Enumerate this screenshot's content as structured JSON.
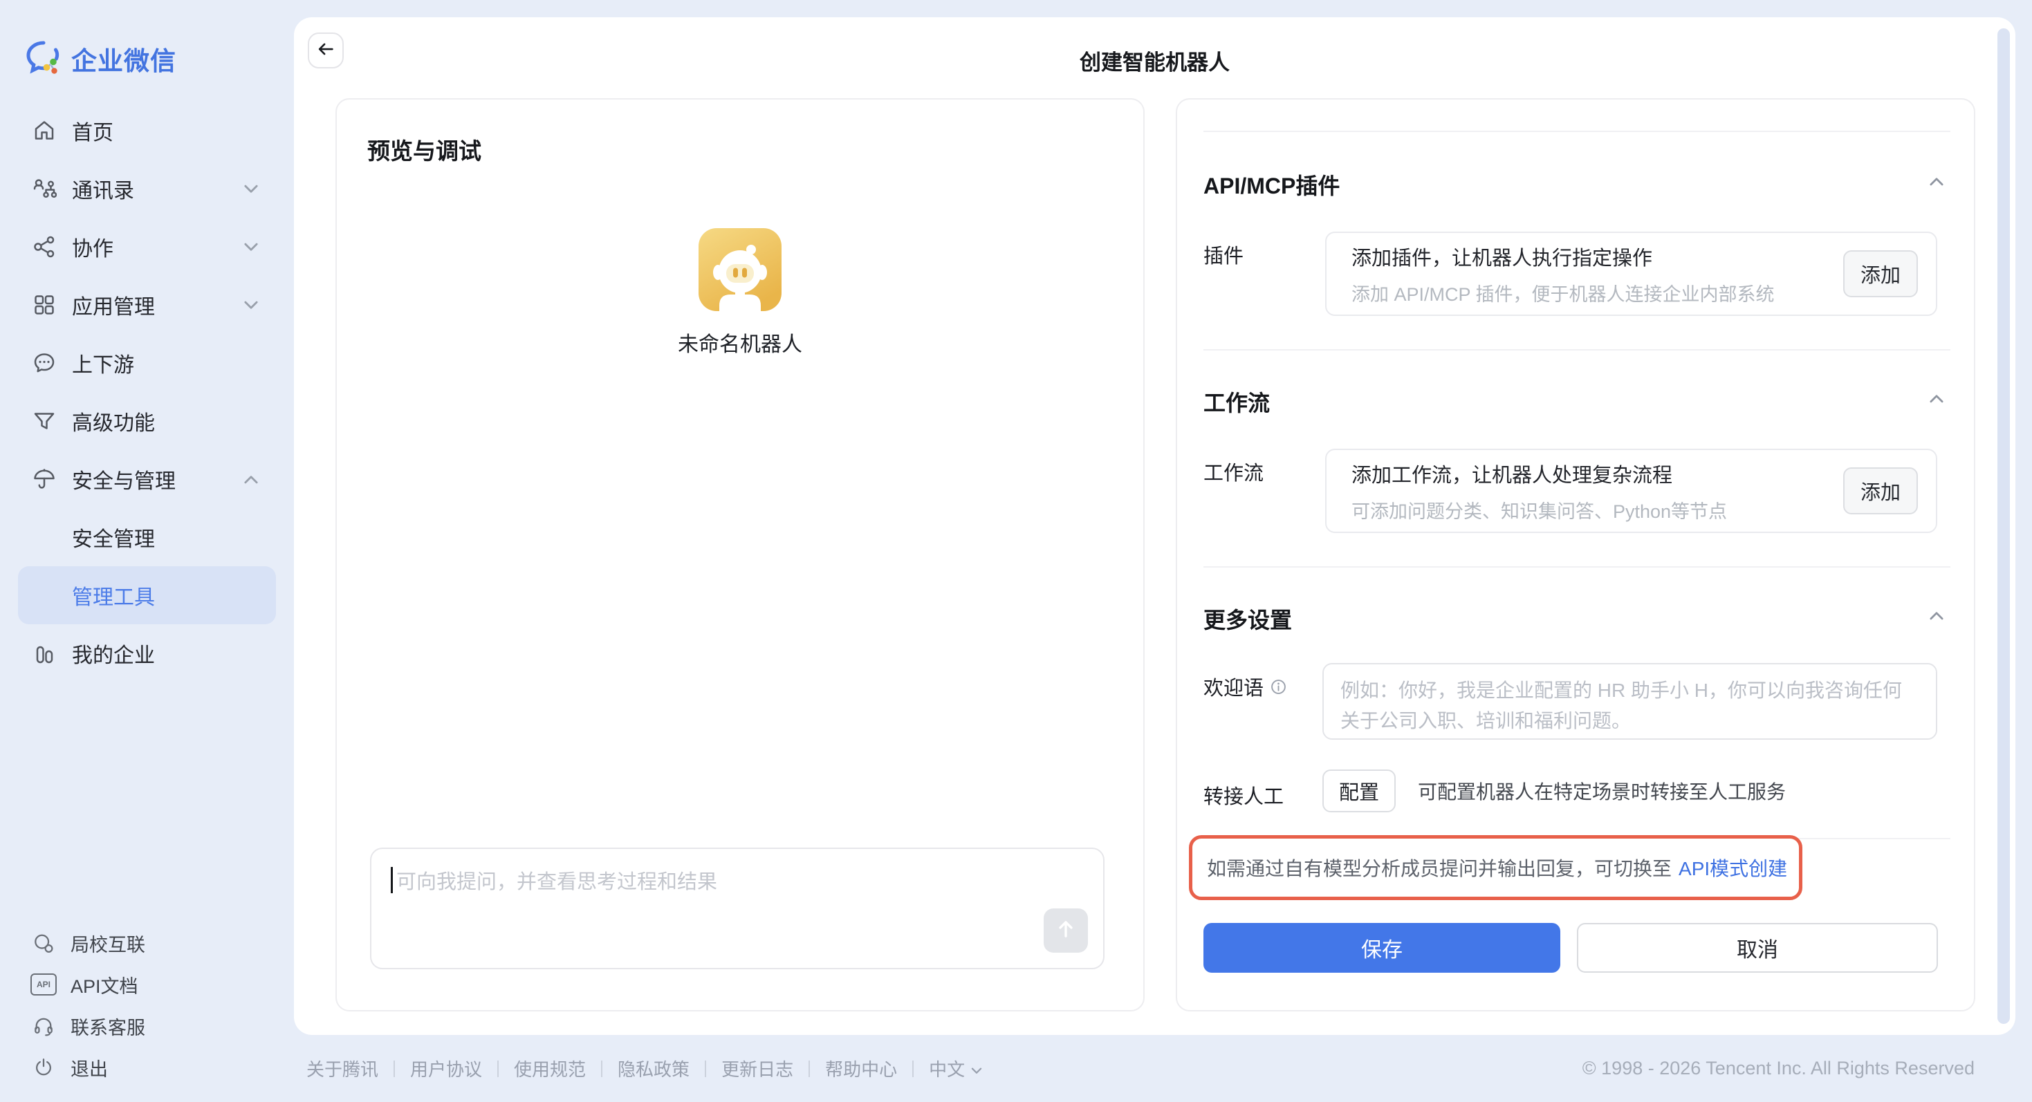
{
  "app": {
    "logo_text": "企业微信"
  },
  "sidebar": {
    "items": [
      {
        "label": "首页"
      },
      {
        "label": "通讯录"
      },
      {
        "label": "协作"
      },
      {
        "label": "应用管理"
      },
      {
        "label": "上下游"
      },
      {
        "label": "高级功能"
      },
      {
        "label": "安全与管理"
      },
      {
        "label": "安全管理"
      },
      {
        "label": "管理工具"
      },
      {
        "label": "我的企业"
      }
    ],
    "footer_items": [
      {
        "label": "局校互联"
      },
      {
        "label": "API文档"
      },
      {
        "label": "联系客服"
      },
      {
        "label": "退出"
      }
    ],
    "api_badge": "API"
  },
  "header": {
    "title": "创建智能机器人"
  },
  "preview": {
    "title": "预览与调试",
    "bot_name": "未命名机器人",
    "input_placeholder": "可向我提问，并查看思考过程和结果"
  },
  "plugin_section": {
    "title": "API/MCP插件",
    "row_label": "插件",
    "card_title": "添加插件，让机器人执行指定操作",
    "card_subtitle": "添加 API/MCP 插件，便于机器人连接企业内部系统",
    "add_label": "添加"
  },
  "workflow_section": {
    "title": "工作流",
    "row_label": "工作流",
    "card_title": "添加工作流，让机器人处理复杂流程",
    "card_subtitle": "可添加问题分类、知识集问答、Python等节点",
    "add_label": "添加"
  },
  "more_section": {
    "title": "更多设置",
    "welcome_label": "欢迎语",
    "welcome_placeholder": "例如：你好，我是企业配置的 HR 助手小 H，你可以向我咨询任何关于公司入职、培训和福利问题。",
    "handoff_label": "转接人工",
    "config_label": "配置",
    "handoff_desc": "可配置机器人在特定场景时转接至人工服务"
  },
  "notice": {
    "text": "如需通过自有模型分析成员提问并输出回复，可切换至",
    "link_label": "API模式创建"
  },
  "actions": {
    "save_label": "保存",
    "cancel_label": "取消"
  },
  "page_footer": {
    "links": [
      {
        "label": "关于腾讯"
      },
      {
        "label": "用户协议"
      },
      {
        "label": "使用规范"
      },
      {
        "label": "隐私政策"
      },
      {
        "label": "更新日志"
      },
      {
        "label": "帮助中心"
      }
    ],
    "language": "中文",
    "copyright": "© 1998 - 2026 Tencent Inc. All Rights Reserved"
  },
  "colors": {
    "primary_blue": "#4377e8",
    "link_blue": "#3e71e2",
    "highlight_red": "#e8604a",
    "avatar_gold": "#e9b54a",
    "page_bg": "#e7edf8",
    "sidebar_selected_bg": "#d8e2f6"
  }
}
